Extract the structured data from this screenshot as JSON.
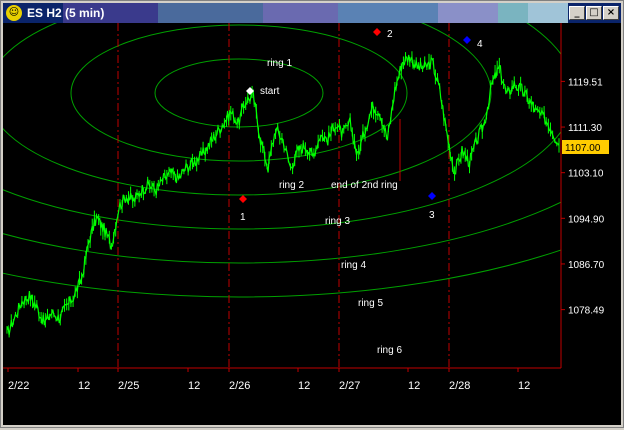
{
  "window": {
    "title": "ES H2 (5 min)",
    "icon": "chart-app-icon",
    "controls": {
      "minimize": "_",
      "maximize": "□",
      "close": "×"
    }
  },
  "colors": {
    "background": "#000000",
    "price": "#00ff00",
    "rings": "#00a000",
    "day_divider": "#c00000",
    "axis": "#c00000",
    "labels": "#ffffff",
    "price_badge": "#ffcc00",
    "marker_red": "#ff0000",
    "marker_blue": "#0000ff",
    "marker_white": "#ffffff"
  },
  "chart_data": {
    "type": "line",
    "y_ticks": [
      "1119.51",
      "1111.30",
      "1103.10",
      "1094.90",
      "1086.70",
      "1078.49"
    ],
    "ylim": [
      1068,
      1130
    ],
    "x_ticks": [
      "2/22",
      "12",
      "2/25",
      "12",
      "2/26",
      "12",
      "2/27",
      "12",
      "2/28",
      "12"
    ],
    "last_price": "1107.00",
    "grid": false,
    "series": [
      {
        "values": [
          1074,
          1077,
          1080,
          1081,
          1079,
          1076,
          1078,
          1077,
          1079,
          1081,
          1084,
          1091,
          1095,
          1093,
          1090,
          1097,
          1099,
          1098,
          1100,
          1101,
          1100,
          1102,
          1103,
          1102,
          1104,
          1105,
          1106,
          1108,
          1110,
          1112,
          1114,
          1112,
          1116,
          1117,
          1109,
          1104,
          1111,
          1109,
          1104,
          1107,
          1108,
          1106,
          1110,
          1109,
          1112,
          1110,
          1112,
          1106,
          1111,
          1115,
          1114,
          1109,
          1118,
          1123,
          1124,
          1122,
          1122,
          1123,
          1118,
          1110,
          1103,
          1107,
          1105,
          1109,
          1112,
          1119,
          1122,
          1117,
          1119,
          1118,
          1116,
          1114,
          1113,
          1111,
          1108
        ]
      }
    ],
    "annotations": [
      {
        "label": "start",
        "kind": "marker"
      },
      {
        "label": "1",
        "kind": "marker"
      },
      {
        "label": "2",
        "kind": "marker"
      },
      {
        "label": "3",
        "kind": "marker"
      },
      {
        "label": "4",
        "kind": "marker"
      },
      {
        "label": "end of 2nd ring",
        "kind": "line"
      }
    ],
    "ring_labels": [
      "ring 1",
      "ring 2",
      "ring 3",
      "ring 4",
      "ring 5",
      "ring 6"
    ]
  }
}
